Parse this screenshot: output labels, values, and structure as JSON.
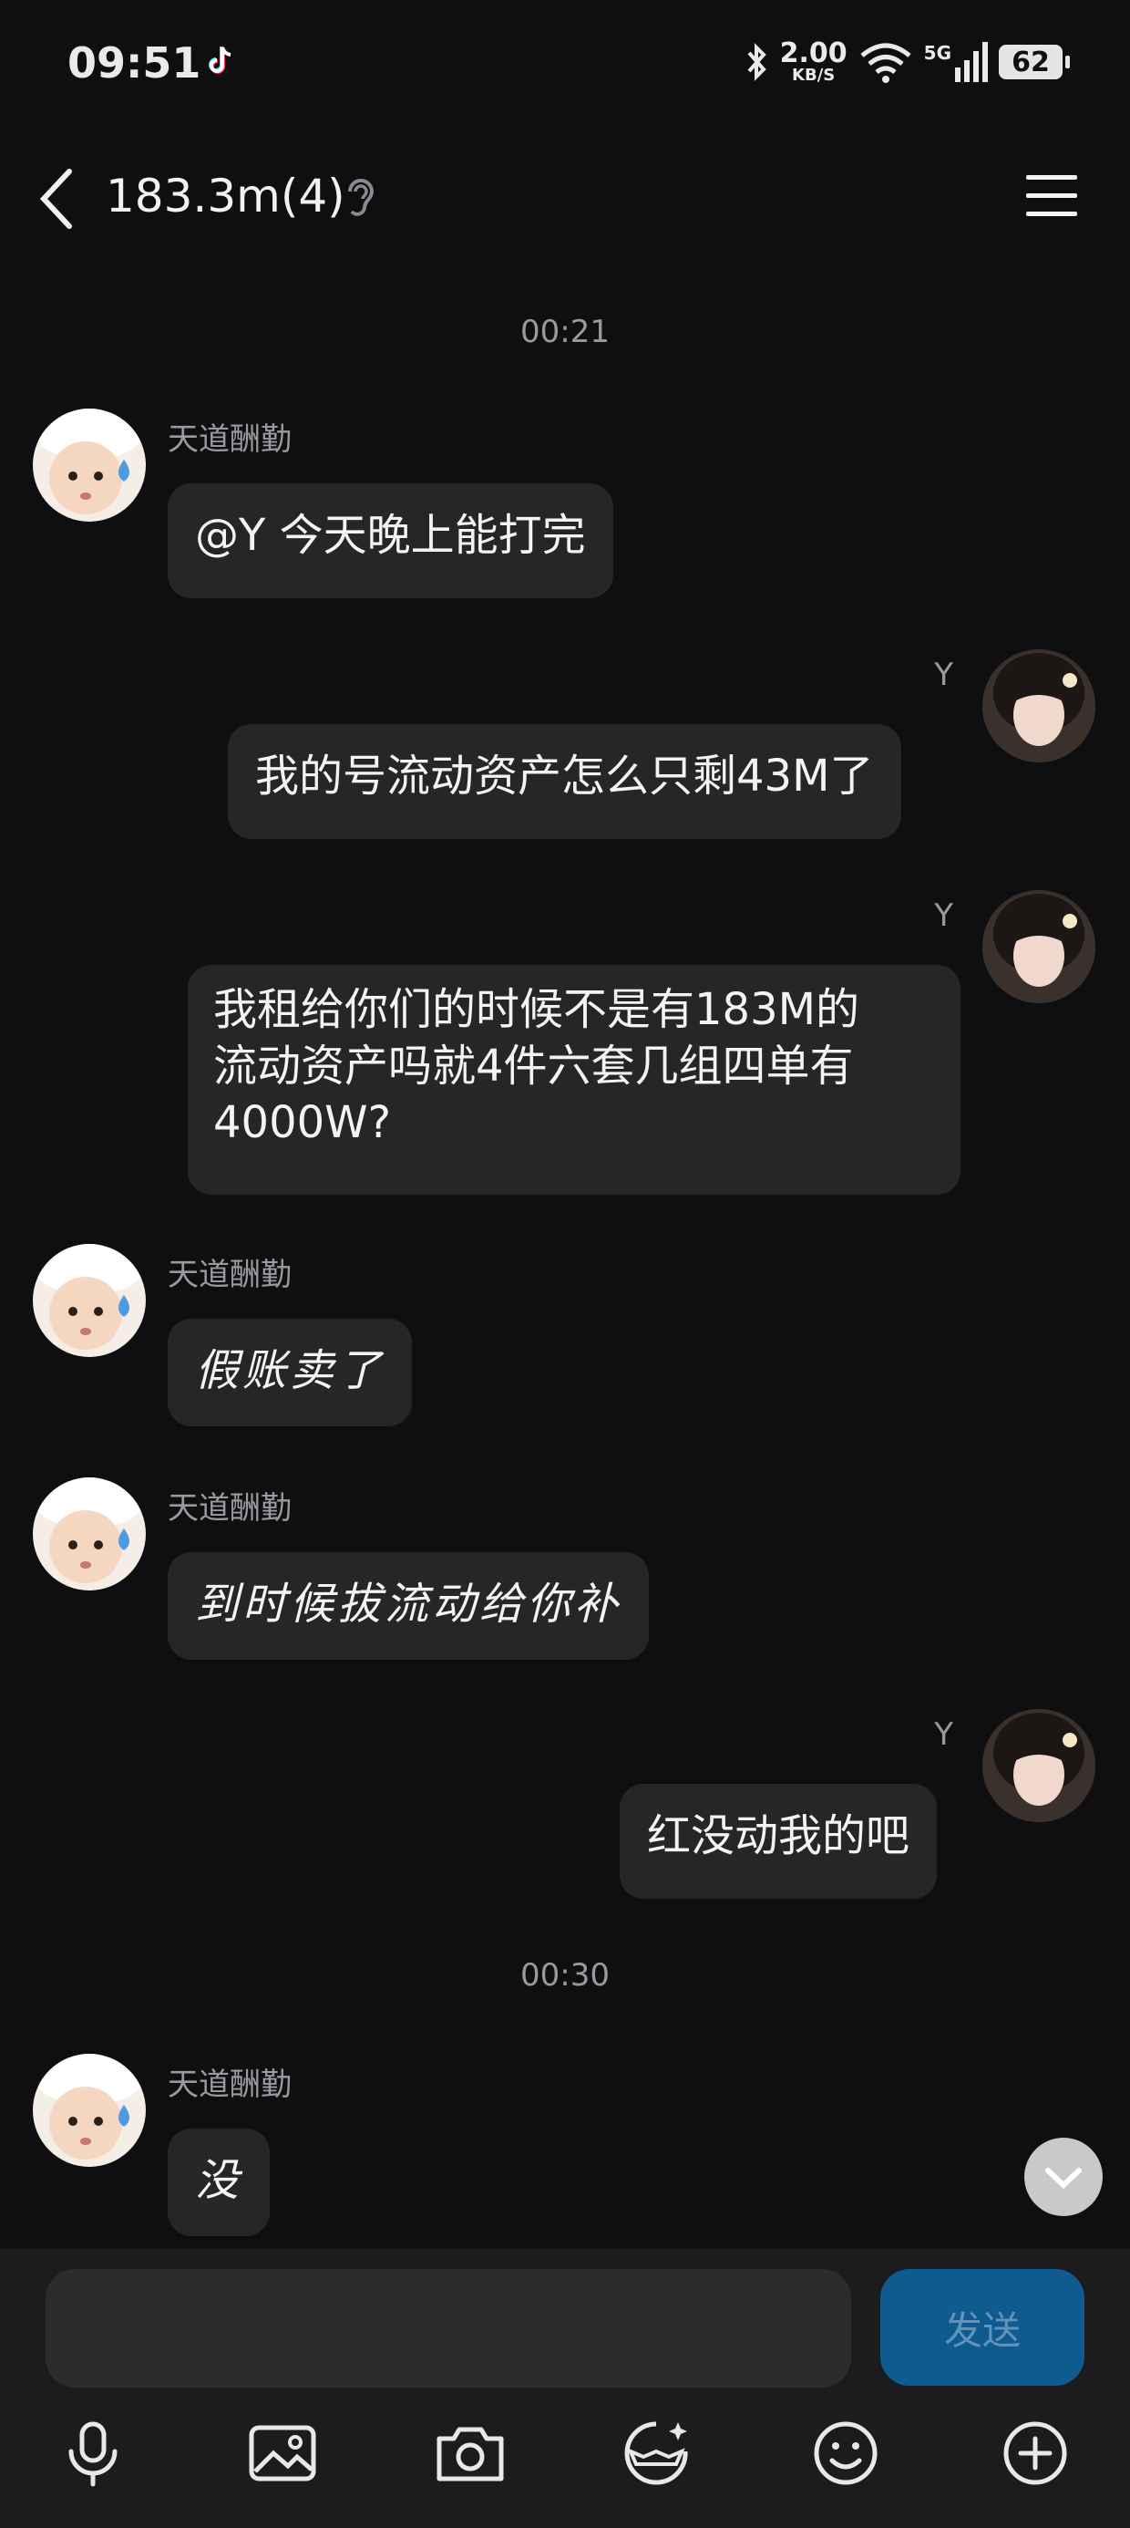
{
  "status_bar": {
    "time": "09:51",
    "speed_value": "2.00",
    "speed_unit": "KB/S",
    "network": "5G",
    "battery": "62"
  },
  "header": {
    "title": "183.3m(4)"
  },
  "messages": [
    {
      "timestamp": "00:21"
    },
    {
      "sender": "天道酬勤",
      "text": "@Y 今天晚上能打完"
    },
    {
      "sender": "Y",
      "text": "我的号流动资产怎么只剩43M了"
    },
    {
      "sender": "Y",
      "text_lines": [
        "我租给你们的时候不是有183M的",
        "流动资产吗就4件六套几组四单有",
        "4000W?"
      ]
    },
    {
      "sender": "天道酬勤",
      "text": "假账卖了"
    },
    {
      "sender": "天道酬勤",
      "text": "到时候拔流动给你补"
    },
    {
      "sender": "Y",
      "text": "红没动我的吧"
    },
    {
      "timestamp": "00:30"
    },
    {
      "sender": "天道酬勤",
      "text": "没"
    }
  ],
  "composer": {
    "input_value": "",
    "send_label": "发送"
  },
  "icons": [
    "back-arrow-icon",
    "hearing-icon",
    "menu-icon",
    "chevron-down-icon",
    "microphone-icon",
    "image-icon",
    "camera-icon",
    "sticker-icon",
    "emoji-icon",
    "plus-icon"
  ]
}
